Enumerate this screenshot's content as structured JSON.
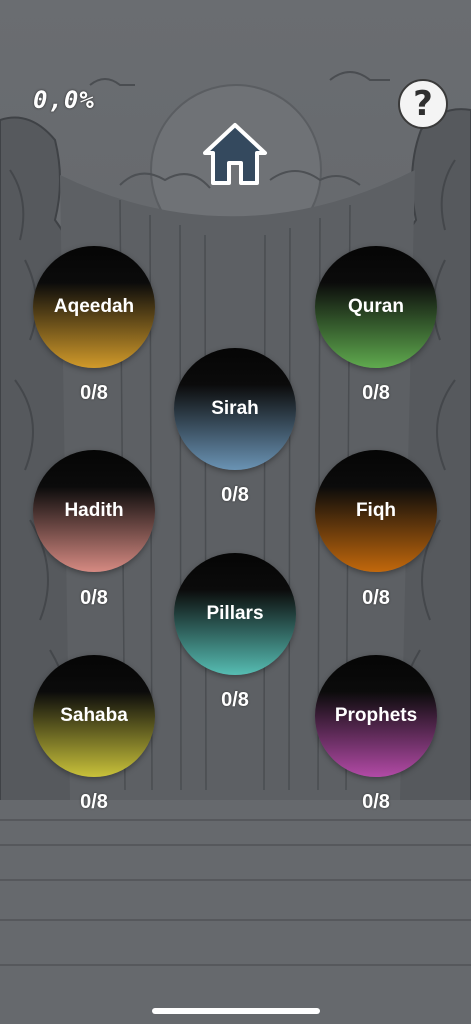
{
  "header": {
    "progress": "0,0%",
    "help_label": "?"
  },
  "topics": [
    {
      "label": "Aqeedah",
      "count": "0/8",
      "color": "#d19a2a"
    },
    {
      "label": "Quran",
      "count": "0/8",
      "color": "#5faa4e"
    },
    {
      "label": "Sirah",
      "count": "0/8",
      "color": "#6a93b4"
    },
    {
      "label": "Hadith",
      "count": "0/8",
      "color": "#d68a82"
    },
    {
      "label": "Fiqh",
      "count": "0/8",
      "color": "#c2680c"
    },
    {
      "label": "Pillars",
      "count": "0/8",
      "color": "#56bdb3"
    },
    {
      "label": "Sahaba",
      "count": "0/8",
      "color": "#c9c23a"
    },
    {
      "label": "Prophets",
      "count": "0/8",
      "color": "#b24aa6"
    }
  ]
}
